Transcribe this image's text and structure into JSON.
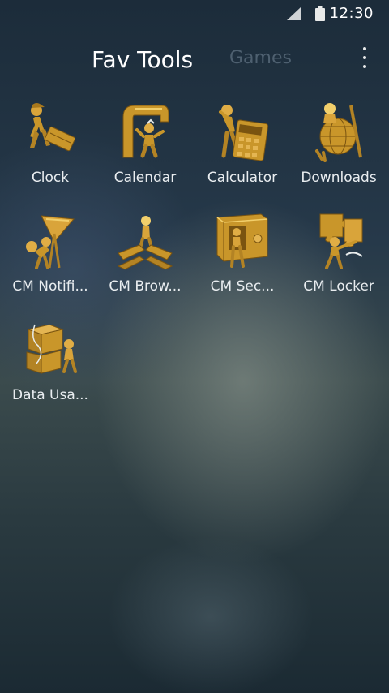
{
  "status_bar": {
    "time": "12:30",
    "signal_icon": "cell-signal-icon",
    "battery_icon": "battery-icon"
  },
  "header": {
    "tabs": [
      {
        "label": "Fav Tools",
        "active": true
      },
      {
        "label": "Games",
        "active": false
      }
    ],
    "menu_icon": "overflow-menu-icon"
  },
  "apps": [
    {
      "label": "Clock",
      "icon": "figure-pushing-box-icon"
    },
    {
      "label": "Calendar",
      "icon": "figure-in-hook-icon"
    },
    {
      "label": "Calculator",
      "icon": "figure-with-calculator-icon"
    },
    {
      "label": "Downloads",
      "icon": "figure-with-globe-icon"
    },
    {
      "label": "CM Notifi...",
      "icon": "figure-with-flag-icon"
    },
    {
      "label": "CM Brow...",
      "icon": "figure-on-crossroads-icon"
    },
    {
      "label": "CM Sec...",
      "icon": "figure-in-safe-icon"
    },
    {
      "label": "CM Locker",
      "icon": "figure-with-puzzle-icon"
    },
    {
      "label": "Data Usa...",
      "icon": "figure-with-boxes-icon"
    }
  ],
  "colors": {
    "gold": "#c9962a",
    "gold_highlight": "#f2cf6b",
    "gold_shadow": "#7a5410",
    "text": "#e9edf0"
  }
}
